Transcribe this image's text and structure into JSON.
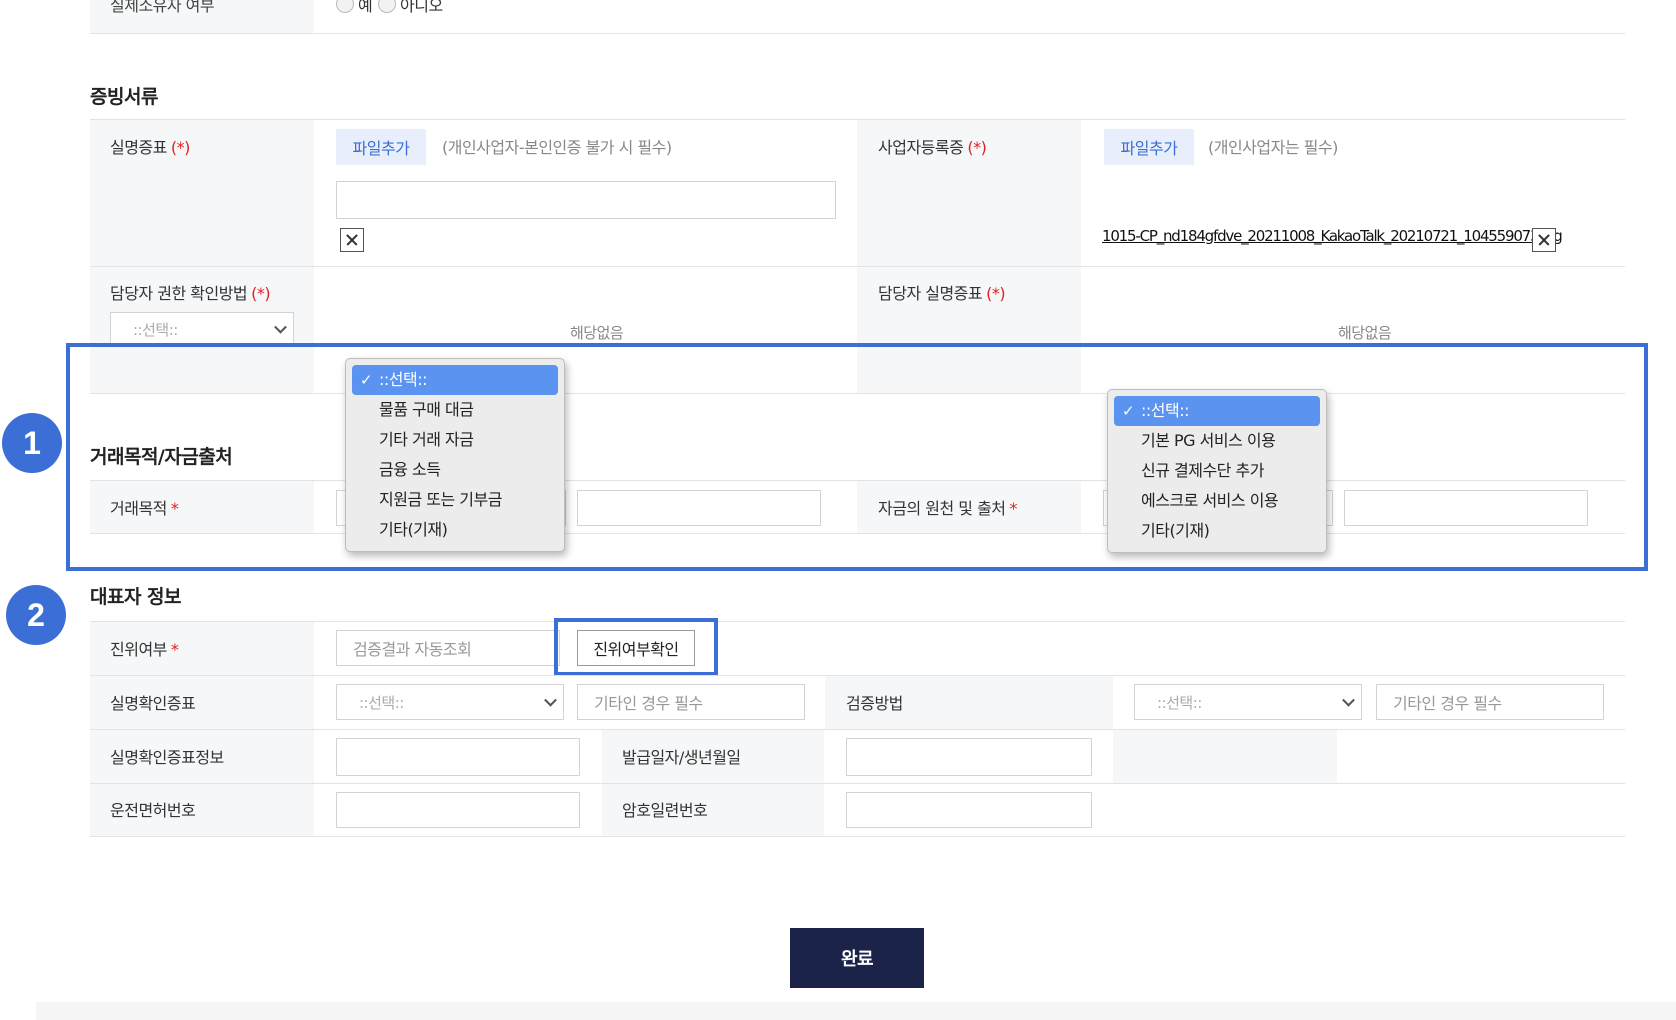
{
  "top_row": {
    "label": "실제소유자 여부",
    "radio_yes": "예",
    "radio_no": "아니오"
  },
  "evidence": {
    "title": "증빙서류",
    "id_proof": {
      "label": "실명증표",
      "req": "(*)",
      "file_button": "파일추가",
      "hint": "(개인사업자-본인인증 불가 시 필수)"
    },
    "biz_reg": {
      "label": "사업자등록증",
      "req": "(*)",
      "file_button": "파일추가",
      "hint": "(개인사업자는 필수)",
      "file_name": "1015-CP_nd184gfdve_20211008_KakaoTalk_20210721_104559073.jpg"
    },
    "auth_method": {
      "label": "담당자 권한 확인방법",
      "req": "(*)",
      "select_value": "::선택::",
      "na": "해당없음"
    },
    "manager_id": {
      "label": "담당자 실명증표",
      "req": "(*)",
      "na": "해당없음"
    }
  },
  "transaction": {
    "title": "거래목적/자금출처",
    "purpose_label": "거래목적",
    "source_label": "자금의 원천 및 출처",
    "req": "*",
    "purpose_options": [
      "::선택::",
      "물품 구매 대금",
      "기타 거래 자금",
      "금융 소득",
      "지원금 또는 기부금",
      "기타(기재)"
    ],
    "source_options": [
      "::선택::",
      "기본 PG 서비스 이용",
      "신규 결제수단 추가",
      "에스크로 서비스 이용",
      "기타(기재)"
    ],
    "check": "✓"
  },
  "representative": {
    "title": "대표자 정보",
    "authenticity_label": "진위여부",
    "req": "*",
    "authenticity_placeholder": "검증결과 자동조회",
    "verify_button": "진위여부확인",
    "id_doc_label": "실명확인증표",
    "id_doc_select": "::선택::",
    "id_doc_other_placeholder": "기타인 경우 필수",
    "verify_method_label": "검증방법",
    "verify_method_select": "::선택::",
    "verify_method_other_placeholder": "기타인 경우 필수",
    "id_info_label": "실명확인증표정보",
    "issue_date_label": "발급일자/생년월일",
    "license_label": "운전면허번호",
    "serial_label": "암호일련번호"
  },
  "badges": [
    "1",
    "2"
  ],
  "done_button": "완료",
  "colors": {
    "accent": "#3b6fd6",
    "done_button": "#1b2448",
    "required": "#e02020",
    "dropdown_selected": "#5b93f0"
  }
}
